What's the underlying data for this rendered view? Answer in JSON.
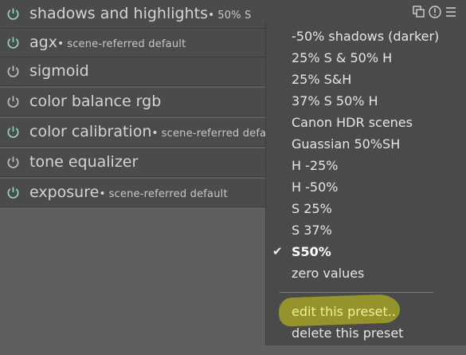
{
  "modules": [
    {
      "name": "shadows and highlights",
      "dot": "•",
      "preset": "50% S",
      "active": true
    },
    {
      "name": "agx",
      "dot": "•",
      "preset": "scene-referred default",
      "active": true
    },
    {
      "name": "sigmoid",
      "dot": "",
      "preset": "",
      "active": false
    },
    {
      "name": "color balance rgb",
      "dot": "",
      "preset": "",
      "active": false
    },
    {
      "name": "color calibration",
      "dot": "•",
      "preset": "scene-referred defa",
      "active": true
    },
    {
      "name": "tone equalizer",
      "dot": "",
      "preset": "",
      "active": false
    },
    {
      "name": "exposure",
      "dot": "•",
      "preset": "scene-referred default",
      "active": true
    }
  ],
  "presets_menu": {
    "items": [
      "-50% shadows (darker)",
      "25% S & 50% H",
      "25% S&H",
      "37% S 50% H",
      "Canon HDR scenes",
      "Guassian 50%SH",
      "H -25%",
      "H -50%",
      "S 25%",
      "S 37%",
      "S50%",
      "zero values"
    ],
    "selected_item": "S50%",
    "check_mark": "✔",
    "actions": [
      "edit this preset..",
      "delete this preset"
    ]
  },
  "colors": {
    "power_active": "#8fd3c7",
    "power_inactive": "#bdbdbd",
    "highlight": "#d4cf12"
  },
  "icons": [
    "power-icon",
    "multi-instance-icon",
    "reset-icon",
    "presets-icon"
  ]
}
